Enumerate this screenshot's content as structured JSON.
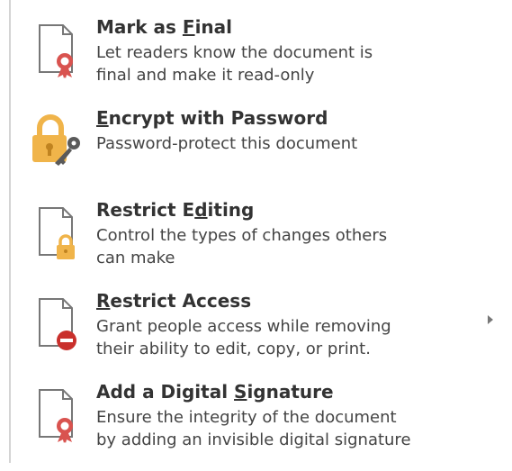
{
  "items": [
    {
      "title_pre": "Mark as ",
      "title_u": "F",
      "title_post": "inal",
      "desc1": "Let readers know the document is",
      "desc2": "final and make it read-only",
      "icon": "document-ribbon-icon"
    },
    {
      "title_pre": "",
      "title_u": "E",
      "title_post": "ncrypt with Password",
      "desc1": "Password-protect this document",
      "desc2": "",
      "icon": "lock-key-icon"
    },
    {
      "title_pre": "Restrict E",
      "title_u": "d",
      "title_post": "iting",
      "desc1": "Control the types of changes others",
      "desc2": "can make",
      "icon": "document-lock-icon"
    },
    {
      "title_pre": "",
      "title_u": "R",
      "title_post": "estrict Access",
      "desc1": "Grant people access while removing",
      "desc2": "their ability to edit, copy, or print.",
      "icon": "document-block-icon"
    },
    {
      "title_pre": "Add a Digital ",
      "title_u": "S",
      "title_post": "ignature",
      "desc1": "Ensure the integrity of the document",
      "desc2": "by adding an invisible digital signature",
      "icon": "document-ribbon-icon"
    }
  ],
  "colors": {
    "ribbon": "#d9534f",
    "lock": "#f0b44a",
    "block": "#c9302c"
  }
}
